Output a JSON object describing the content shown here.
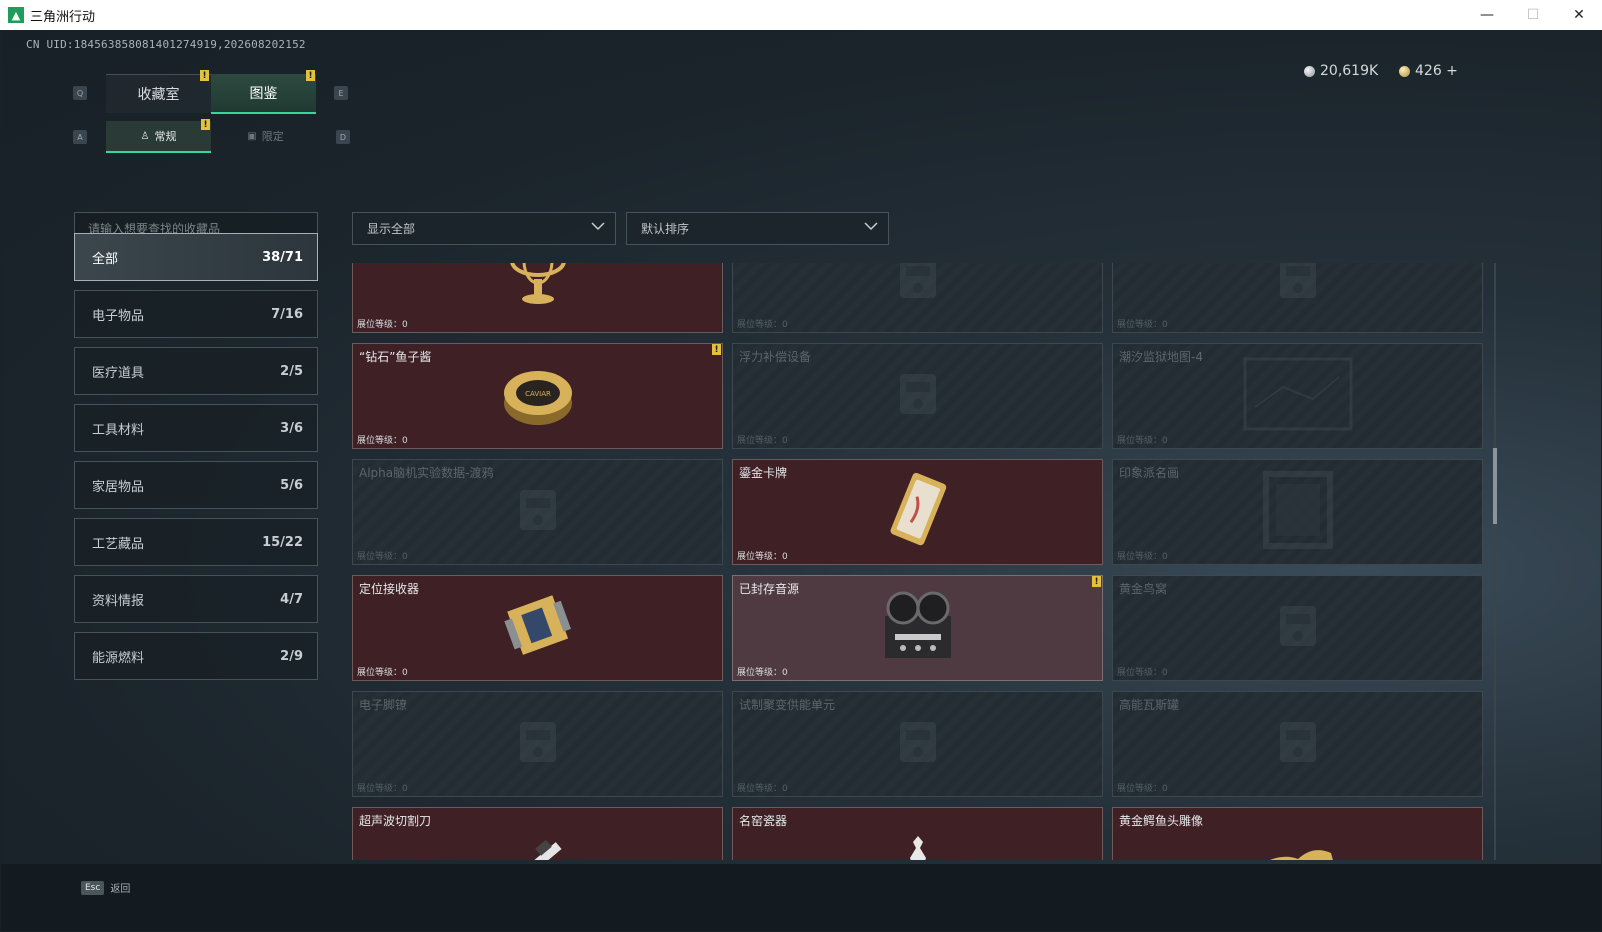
{
  "window": {
    "title": "三角洲行动",
    "minimize": "—",
    "maximize": "☐",
    "close": "✕"
  },
  "uid": "CN UID:1845638580814012749​19,202608202152",
  "keys": {
    "q": "Q",
    "e": "E",
    "a": "A",
    "d": "D"
  },
  "tabs": [
    {
      "label": "收藏室"
    },
    {
      "label": "图鉴"
    }
  ],
  "subtabs": [
    {
      "label": "常规"
    },
    {
      "label": "限定"
    }
  ],
  "badge": "!",
  "currency": [
    {
      "value": "20,619K"
    },
    {
      "value": "426 +"
    }
  ],
  "search": {
    "placeholder": "请输入想要查找的收藏品"
  },
  "filters": [
    {
      "label": "显示全部"
    },
    {
      "label": "默认排序"
    }
  ],
  "categories": [
    {
      "label": "全部",
      "count": "38/71"
    },
    {
      "label": "电子物品",
      "count": "7/16"
    },
    {
      "label": "医疗道具",
      "count": "2/5"
    },
    {
      "label": "工具材料",
      "count": "3/6"
    },
    {
      "label": "家居物品",
      "count": "5/6"
    },
    {
      "label": "工艺藏品",
      "count": "15/22"
    },
    {
      "label": "资料情报",
      "count": "4/7"
    },
    {
      "label": "能源燃料",
      "count": "2/9"
    }
  ],
  "level_label": "展位等级：0",
  "items": [
    {
      "name": "",
      "owned": true,
      "icon": "gold-armillary-icon"
    },
    {
      "name": "",
      "owned": false,
      "icon": "chess-icon"
    },
    {
      "name": "",
      "owned": false,
      "icon": "machine-icon"
    },
    {
      "name": "“钻石”鱼子酱",
      "owned": true,
      "icon": "caviar-tin-icon",
      "badge": true
    },
    {
      "name": "浮力补偿设备",
      "owned": false,
      "icon": "bcd-icon"
    },
    {
      "name": "潮汐监狱地图-4",
      "owned": false,
      "icon": "map-icon"
    },
    {
      "name": "Alpha脑机实验数据-渡鸦",
      "owned": false,
      "icon": "drive-icon"
    },
    {
      "name": "鎏金卡牌",
      "owned": true,
      "icon": "gilded-card-icon"
    },
    {
      "name": "印象派名画",
      "owned": false,
      "icon": "painting-icon"
    },
    {
      "name": "定位接收器",
      "owned": true,
      "icon": "gps-receiver-icon"
    },
    {
      "name": "已封存音源",
      "owned": true,
      "icon": "tape-recorder-icon",
      "badge": true
    },
    {
      "name": "黄金鸟窝",
      "owned": false,
      "icon": "nest-icon"
    },
    {
      "name": "电子脚镣",
      "owned": false,
      "icon": "ankle-monitor-icon"
    },
    {
      "name": "试制聚变供能单元",
      "owned": false,
      "icon": "fusion-cell-icon"
    },
    {
      "name": "高能瓦斯罐",
      "owned": false,
      "icon": "gas-tank-icon"
    },
    {
      "name": "超声波切割刀",
      "owned": true,
      "icon": "ultrasonic-blade-icon"
    },
    {
      "name": "名窑瓷器",
      "owned": true,
      "icon": "porcelain-icon"
    },
    {
      "name": "黄金鳄鱼头雕像",
      "owned": true,
      "icon": "gold-croc-icon"
    }
  ],
  "footer": {
    "key": "Esc",
    "label": "返回"
  }
}
